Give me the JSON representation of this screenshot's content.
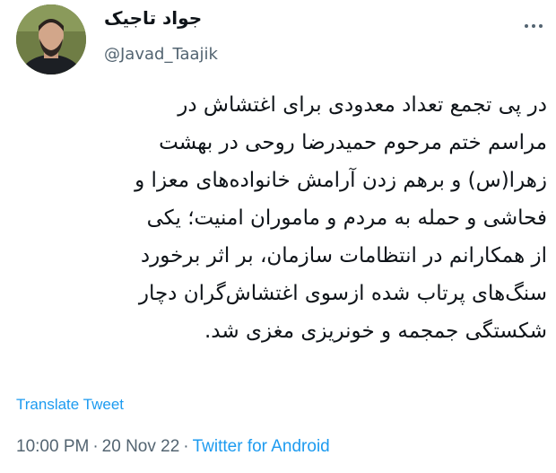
{
  "author": {
    "display_name": "جواد تاجیک",
    "handle": "@Javad_Taajik"
  },
  "tweet": {
    "lines": [
      "در پی تجمع تعداد معدودی برای اغتشاش در",
      "مراسم ختم مرحوم حمیدرضا روحی در بهشت",
      "زهرا(س) و برهم زدن آرامش خانواده‌های معزا و",
      "فحاشی و حمله به مردم و ماموران امنیت؛ یکی",
      "از همکارانم در انتظامات سازمان، بر اثر برخورد",
      "سنگ‌های پرتاب شده ازسوی اغتشاش‌گران دچار",
      "شکستگی جمجمه و خونریزی مغزی شد."
    ],
    "translate_label": "Translate Tweet",
    "time": "10:00 PM",
    "separator": "·",
    "date": "20 Nov 22",
    "source": "Twitter for Android"
  },
  "colors": {
    "link": "#1d9bf0",
    "muted": "#536471",
    "text": "#0f1419"
  },
  "icons": {
    "more": "more-horizontal-icon"
  }
}
